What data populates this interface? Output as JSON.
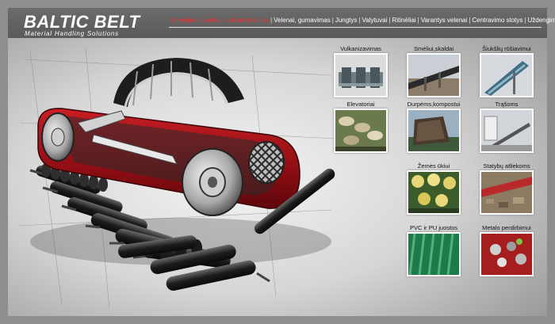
{
  "brand": {
    "name": "BALTIC BELT",
    "tagline": "Material Handling Solutions"
  },
  "nav": [
    {
      "label": "Konvejerio juostos, vulkanizavimas",
      "active": true
    },
    {
      "label": "Velenai, gumavimas"
    },
    {
      "label": "Jungtys"
    },
    {
      "label": "Valytuvai"
    },
    {
      "label": "Ritinėliai"
    },
    {
      "label": "Varantys velenai"
    },
    {
      "label": "Centravimo stotys"
    },
    {
      "label": "Uždengimai"
    }
  ],
  "categories": [
    {
      "label": "Vulkanizavimas"
    },
    {
      "label": "Smėliui,skaldai"
    },
    {
      "label": "Šiukšlių rūšiavimui"
    },
    {
      "label": "Elevatoriai"
    },
    {
      "label": "Durpėms,kompostui"
    },
    {
      "label": "Trąšoms"
    },
    {
      "label": "Žemės ūkiui"
    },
    {
      "label": "Statybų atliekoms"
    },
    {
      "label": "PVC ir PU juostos"
    },
    {
      "label": "Metalo perdirbimui"
    }
  ]
}
